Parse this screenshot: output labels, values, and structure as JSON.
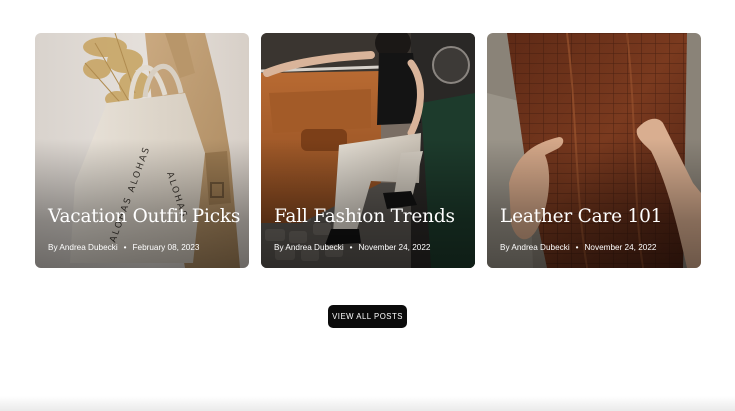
{
  "posts": [
    {
      "title": "Vacation Outfit Picks",
      "author": "By Andrea Dubecki",
      "separator": "•",
      "date": "February 08, 2023",
      "image": "tote-bag-and-trench-coat-photo",
      "tote_text": "ALOHAS ALOHAS ALOHAS"
    },
    {
      "title": "Fall Fashion Trends",
      "author": "By Andrea Dubecki",
      "separator": "•",
      "date": "November 24, 2022",
      "image": "woman-in-vintage-car-photo"
    },
    {
      "title": "Leather Care 101",
      "author": "By Andrea Dubecki",
      "separator": "•",
      "date": "November 24, 2022",
      "image": "hands-holding-leather-photo"
    }
  ],
  "view_all_label": "VIEW ALL POSTS",
  "colors": {
    "button_bg": "#0b0b0b",
    "button_text": "#ffffff",
    "page_bg": "#ffffff",
    "card_text": "#ffffff"
  }
}
